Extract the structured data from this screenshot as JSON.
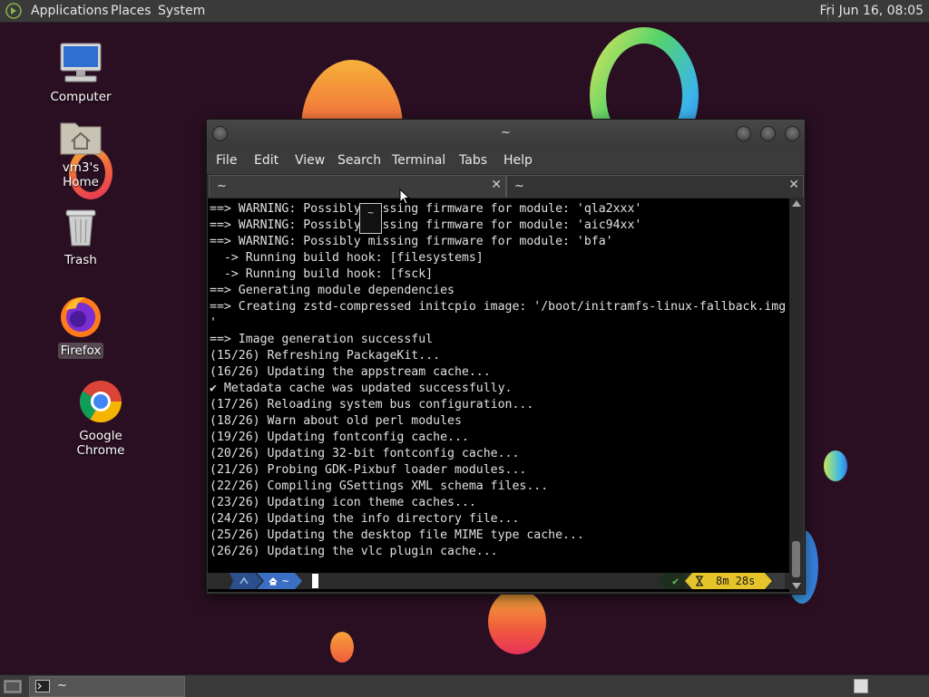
{
  "top_panel": {
    "menus": [
      "Applications",
      "Places",
      "System"
    ],
    "clock": "Fri Jun 16, 08:05"
  },
  "desktop_icons": [
    {
      "label": "Computer",
      "icon": "computer-icon"
    },
    {
      "label": "vm3's Home",
      "icon": "home-folder-icon"
    },
    {
      "label": "Trash",
      "icon": "trash-icon"
    },
    {
      "label": "Firefox",
      "icon": "firefox-icon"
    },
    {
      "label": "Google Chrome",
      "icon": "chrome-icon"
    }
  ],
  "terminal": {
    "title": "~",
    "menu": [
      "File",
      "Edit",
      "View",
      "Search",
      "Terminal",
      "Tabs",
      "Help"
    ],
    "tabs": [
      {
        "label": "~",
        "close": "✕"
      },
      {
        "label": "~",
        "close": "✕"
      }
    ],
    "tooltip": "~",
    "lines": [
      "==> WARNING: Possibly missing firmware for module: 'qla2xxx'",
      "==> WARNING: Possibly missing firmware for module: 'aic94xx'",
      "==> WARNING: Possibly missing firmware for module: 'bfa'",
      "  -> Running build hook: [filesystems]",
      "  -> Running build hook: [fsck]",
      "==> Generating module dependencies",
      "==> Creating zstd-compressed initcpio image: '/boot/initramfs-linux-fallback.img",
      "'",
      "==> Image generation successful",
      "(15/26) Refreshing PackageKit...",
      "(16/26) Updating the appstream cache...",
      "✔ Metadata cache was updated successfully.",
      "(17/26) Reloading system bus configuration...",
      "(18/26) Warn about old perl modules",
      "(19/26) Updating fontconfig cache...",
      "(20/26) Updating 32-bit fontconfig cache...",
      "(21/26) Probing GDK-Pixbuf loader modules...",
      "(22/26) Compiling GSettings XML schema files...",
      "(23/26) Updating icon theme caches...",
      "(24/26) Updating the info directory file...",
      "(25/26) Updating the desktop file MIME type cache...",
      "(26/26) Updating the vlc plugin cache..."
    ],
    "prompt": {
      "dir": "~",
      "status_ok": "✔",
      "duration": "8m 28s"
    }
  },
  "taskbar": {
    "window_label": "~"
  },
  "colors": {
    "prompt_blue": "#3b6fc4",
    "prompt_yellow": "#e5c32a",
    "prompt_green": "#4caf50"
  }
}
